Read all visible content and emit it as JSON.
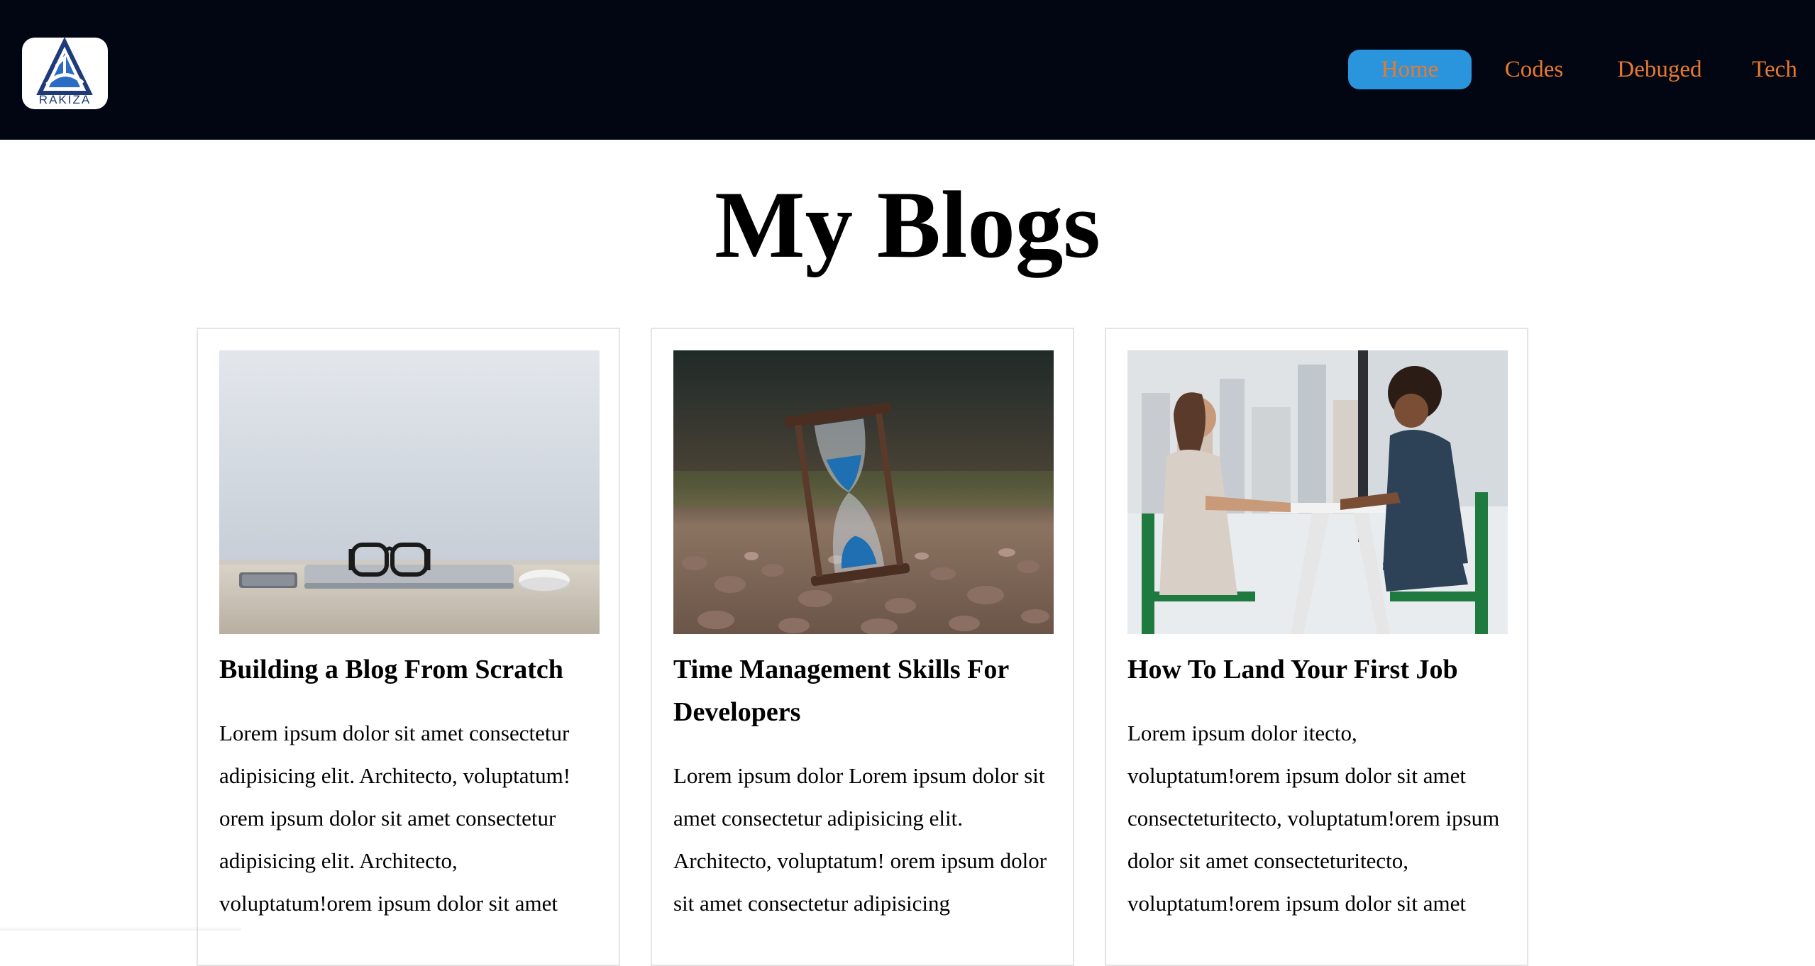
{
  "header": {
    "logo_text": "RAKIZA",
    "logo_icon": "rakiza-triangle-logo",
    "nav": [
      {
        "label": "Home",
        "active": true
      },
      {
        "label": "Codes",
        "active": false
      },
      {
        "label": "Debuged",
        "active": false
      },
      {
        "label": "Tech",
        "active": false
      }
    ],
    "colors": {
      "background": "#020613",
      "nav_text": "#e8792f",
      "active_bg": "#2a95dc"
    }
  },
  "main": {
    "title": "My Blogs",
    "cards": [
      {
        "image": "laptop-glasses-desk-photo",
        "title": "Building a Blog From Scratch",
        "body": "Lorem ipsum dolor sit amet consectetur adipisicing elit. Architecto, voluptatum! orem ipsum dolor sit amet consectetur adipisicing elit. Architecto, voluptatum!orem ipsum dolor sit amet"
      },
      {
        "image": "hourglass-on-pebbles-photo",
        "title": "Time Management Skills For Developers",
        "body": "Lorem ipsum dolor Lorem ipsum dolor sit amet consectetur adipisicing elit. Architecto, voluptatum! orem ipsum dolor sit amet consectetur adipisicing"
      },
      {
        "image": "two-women-interview-photo",
        "title": "How To Land Your First Job",
        "body": "Lorem ipsum dolor itecto, voluptatum!orem ipsum dolor sit amet consecteturitecto, voluptatum!orem ipsum dolor sit amet consecteturitecto, voluptatum!orem ipsum dolor sit amet"
      }
    ]
  }
}
